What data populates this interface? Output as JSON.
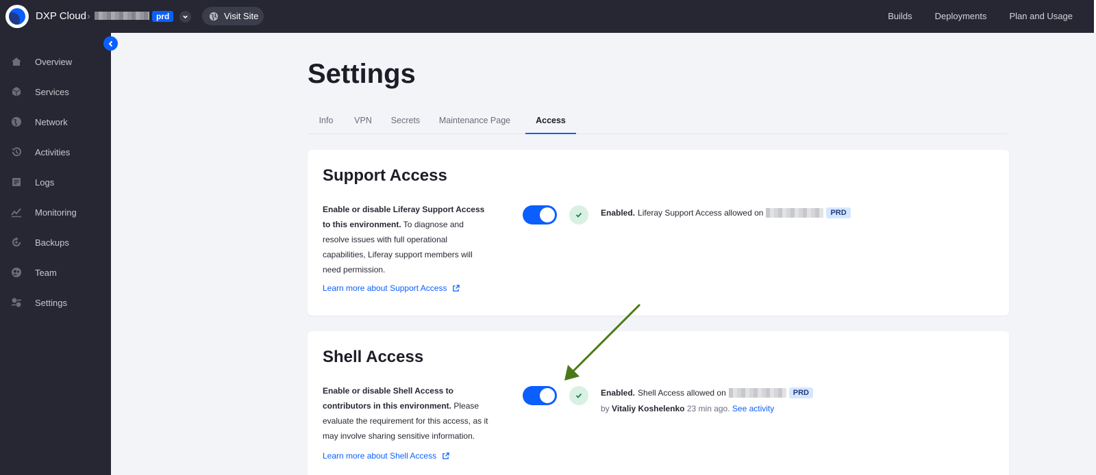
{
  "app": {
    "title": "DXP Cloud",
    "env_badge": "prd",
    "visit_site": "Visit Site"
  },
  "topnav": {
    "builds": "Builds",
    "deployments": "Deployments",
    "plan": "Plan and Usage"
  },
  "sidebar": {
    "items": [
      {
        "label": "Overview",
        "icon": "home-icon"
      },
      {
        "label": "Services",
        "icon": "cube-icon"
      },
      {
        "label": "Network",
        "icon": "globe-icon"
      },
      {
        "label": "Activities",
        "icon": "history-icon"
      },
      {
        "label": "Logs",
        "icon": "logs-icon"
      },
      {
        "label": "Monitoring",
        "icon": "chart-icon"
      },
      {
        "label": "Backups",
        "icon": "backup-icon"
      },
      {
        "label": "Team",
        "icon": "team-icon"
      },
      {
        "label": "Settings",
        "icon": "settings-icon"
      }
    ]
  },
  "page": {
    "title": "Settings"
  },
  "tabs": [
    "Info",
    "VPN",
    "Secrets",
    "Maintenance Page",
    "Access"
  ],
  "support": {
    "title": "Support Access",
    "desc_bold": "Enable or disable Liferay Support Access to this environment.",
    "desc_rest": " To diagnose and resolve issues with full operational capabilities, Liferay support members will need permission.",
    "learn": "Learn more about Support Access",
    "status_bold": "Enabled.",
    "status_text": "Liferay Support Access allowed on",
    "badge": "PRD"
  },
  "shell": {
    "title": "Shell Access",
    "desc_bold": "Enable or disable Shell Access to contributors in this environment.",
    "desc_rest": " Please evaluate the requirement for this access, as it may involve sharing sensitive information.",
    "learn": "Learn more about Shell Access",
    "status_bold": "Enabled.",
    "status_text": "Shell Access allowed on",
    "badge": "PRD",
    "by": "by",
    "user": "Vitaliy Koshelenko",
    "time": "23 min ago",
    "see_activity": "See activity"
  },
  "colors": {
    "accent": "#0b5fff",
    "sidebar": "#262733",
    "annotation_arrow": "#4a7a18"
  }
}
